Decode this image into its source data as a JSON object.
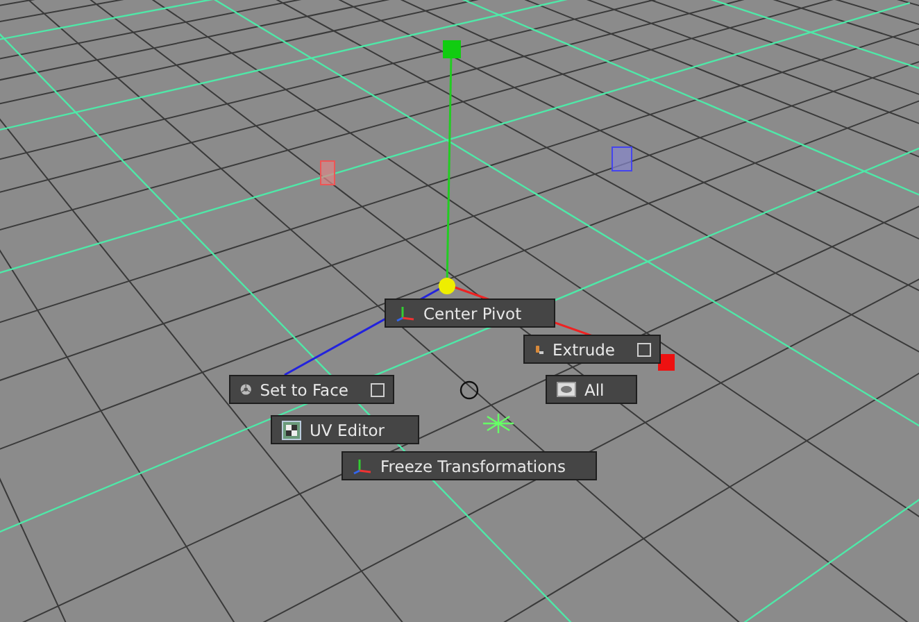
{
  "marking_menu": {
    "items": [
      {
        "label": "Center Pivot",
        "kind": "axes",
        "option_box": false
      },
      {
        "label": "Extrude",
        "kind": "extrude",
        "option_box": true
      },
      {
        "label": "Set to Face",
        "kind": "face",
        "option_box": true
      },
      {
        "label": "All",
        "kind": "display",
        "option_box": false
      },
      {
        "label": "UV Editor",
        "kind": "uv",
        "option_box": false
      },
      {
        "label": "Freeze Transformations",
        "kind": "axes",
        "option_box": false
      }
    ]
  }
}
